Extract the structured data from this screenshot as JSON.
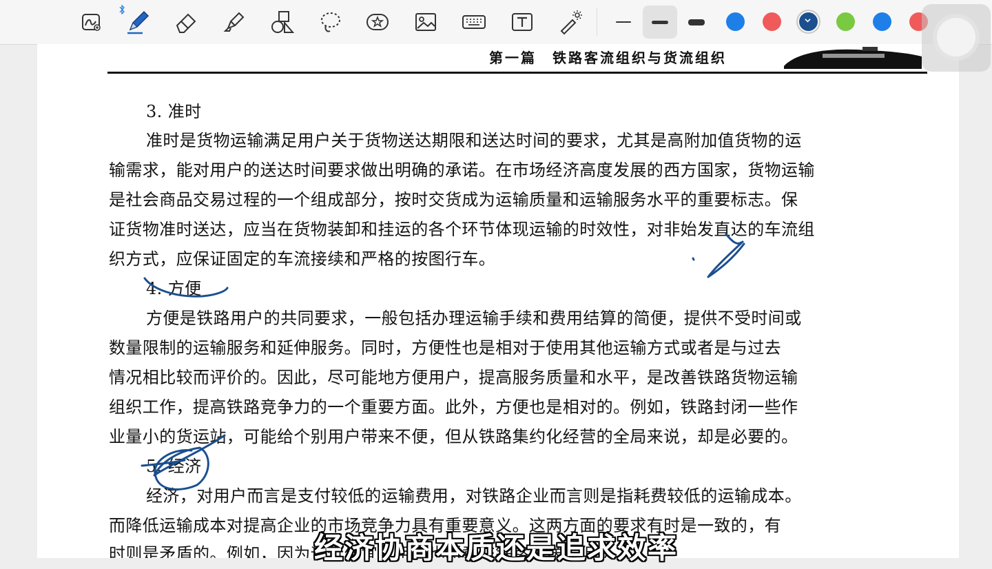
{
  "toolbar": {
    "tools": [
      {
        "name": "lasso-select-tool",
        "icon": "lasso-pen-icon"
      },
      {
        "name": "pen-tool",
        "icon": "fountain-pen-icon"
      },
      {
        "name": "eraser-tool",
        "icon": "eraser-icon"
      },
      {
        "name": "highlighter-tool",
        "icon": "highlighter-icon"
      },
      {
        "name": "shapes-tool",
        "icon": "shapes-icon"
      },
      {
        "name": "lasso-tool",
        "icon": "lasso-icon"
      },
      {
        "name": "sticker-tool",
        "icon": "star-sticker-icon"
      },
      {
        "name": "image-tool",
        "icon": "image-icon"
      },
      {
        "name": "keyboard-tool",
        "icon": "keyboard-icon"
      },
      {
        "name": "text-tool",
        "icon": "text-box-icon"
      },
      {
        "name": "laser-pointer-tool",
        "icon": "laser-pointer-icon"
      }
    ],
    "strokes": [
      "thin",
      "medium",
      "thick"
    ],
    "selected_stroke": "medium",
    "colors": [
      "#1f7fe8",
      "#f05a5a",
      "#1b4f8f",
      "#7ac943",
      "#1f7fe8",
      "#f05a5a"
    ],
    "selected_color": "#1b4f8f"
  },
  "page": {
    "header": "第一篇　铁路客流组织与货流组织",
    "lines": [
      "3. 准时",
      "准时是货物运输满足用户关于货物送达期限和送达时间的要求，尤其是高附加值货物的运",
      "输需求，能对用户的送达时间要求做出明确的承诺。在市场经济高度发展的西方国家，货物运输",
      "是社会商品交易过程的一个组成部分，按时交货成为运输质量和运输服务水平的重要标志。保",
      "证货物准时送达，应当在货物装卸和挂运的各个环节体现运输的时效性，对非始发直达的车流组",
      "织方式，应保证固定的车流接续和严格的按图行车。",
      "4. 方便",
      "方便是铁路用户的共同要求，一般包括办理运输手续和费用结算的简便，提供不受时间或",
      "数量限制的运输服务和延伸服务。同时，方便性也是相对于使用其他运输方式或者是与过去",
      "情况相比较而评价的。因此，尽可能地方便用户，提高服务质量和水平，是改善铁路货物运输",
      "组织工作，提高铁路竞争力的一个重要方面。此外，方便也是相对的。例如，铁路封闭一些作",
      "业量小的货运站，可能给个别用户带来不便，但从铁路集约化经营的全局来说，却是必要的。",
      "5. 经济",
      "经济，对用户而言是支付较低的运输费用，对铁路企业而言则是指耗费较低的运输成本。",
      "而降低运输成本对提高企业的市场竞争力具有重要意义。这两方面的要求有时是一致的，有",
      "时则是矛盾的。例如，因为运价便宜，用户也愿意交铁路运送，但从"
    ]
  },
  "subtitle": "经济协商本质还是追求效率",
  "ink_color": "#1b4f8f"
}
